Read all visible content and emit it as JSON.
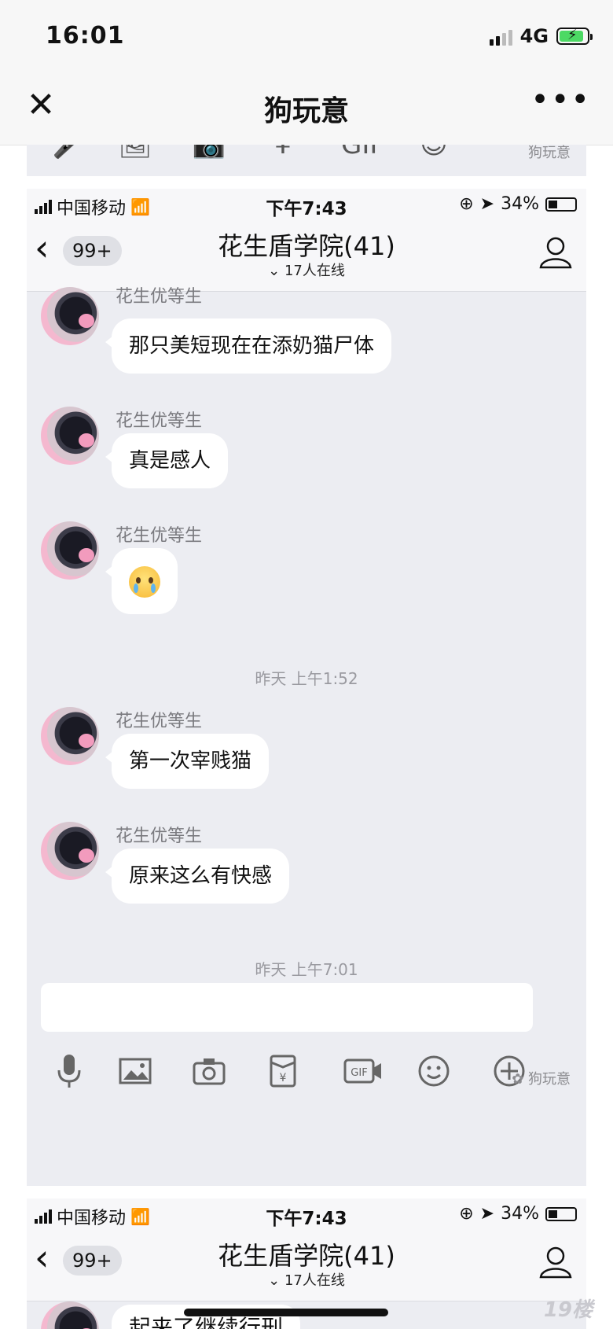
{
  "outer": {
    "time": "16:01",
    "network": "4G",
    "title": "狗玩意",
    "close_icon": "close-icon",
    "more_icon": "more-icon"
  },
  "chat": {
    "carrier": "中国移动",
    "time": "下午7:43",
    "battery": "34%",
    "back_badge": "99+",
    "title": "花生盾学院(41)",
    "online": "17人在线",
    "sender": "花生优等生",
    "messages": [
      {
        "text": "那只美短现在在添奶猫尸体"
      },
      {
        "text": "真是感人"
      },
      {
        "emoji": "crying-face-emoji"
      },
      {
        "timestamp": "昨天 上午1:52"
      },
      {
        "text": "第一次宰贱猫"
      },
      {
        "text": "原来这么有快感"
      },
      {
        "timestamp": "昨天 上午7:01"
      }
    ],
    "watermark": "狗玩意",
    "partial_message": "起来了继续行刑"
  },
  "site_watermark": "19楼",
  "colors": {
    "chat_bg": "#ecedf2",
    "bubble": "#ffffff",
    "battery_charge": "#4cd964"
  }
}
